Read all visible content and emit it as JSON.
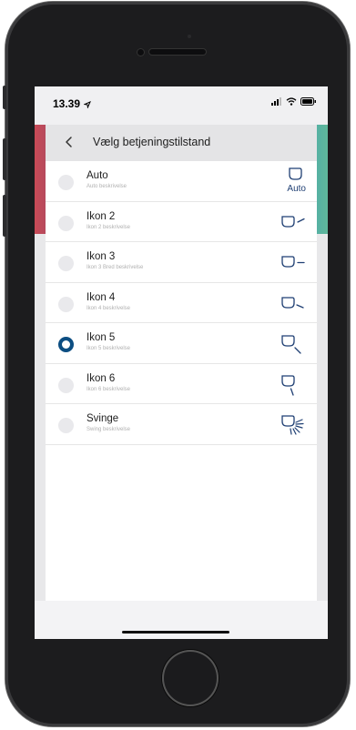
{
  "status_bar": {
    "time": "13.39",
    "icons": [
      "location-arrow-icon",
      "signal-bars-icon",
      "wifi-icon",
      "battery-icon"
    ]
  },
  "header": {
    "back_icon": "chevron-left-icon",
    "title": "Vælg betjeningstilstand"
  },
  "modes": [
    {
      "title": "Auto",
      "description": "Auto beskrivelse",
      "icon": "louver-auto-icon",
      "icon_label": "Auto",
      "selected": false
    },
    {
      "title": "Ikon 2",
      "description": "Ikon 2 beskrivelse",
      "icon": "louver-position-2-icon",
      "selected": false
    },
    {
      "title": "Ikon 3",
      "description": "Ikon 3 Bred beskrivelse",
      "icon": "louver-position-3-icon",
      "selected": false
    },
    {
      "title": "Ikon 4",
      "description": "Ikon 4 beskrivelse",
      "icon": "louver-position-4-icon",
      "selected": false
    },
    {
      "title": "Ikon 5",
      "description": "Ikon 5 beskrivelse",
      "icon": "louver-position-5-icon",
      "selected": true
    },
    {
      "title": "Ikon 6",
      "description": "Ikon 6 beskrivelse",
      "icon": "louver-position-6-icon",
      "selected": false
    },
    {
      "title": "Svinge",
      "description": "Swing beskrivelse",
      "icon": "louver-swing-icon",
      "selected": false
    }
  ],
  "colors": {
    "accent": "#0c4e82",
    "icon_stroke": "#1f3f73",
    "header_bg": "#e4e4e6",
    "phone_body": "#1c1c1e"
  }
}
